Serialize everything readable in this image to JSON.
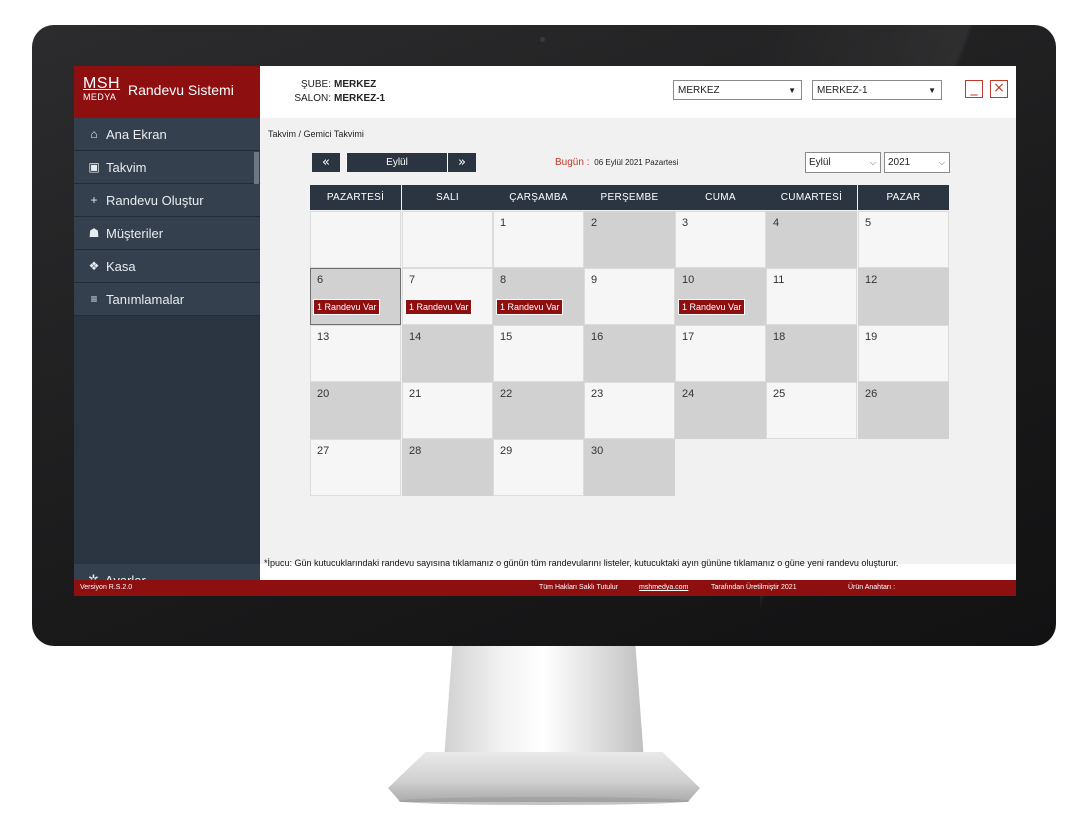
{
  "app": {
    "logo_top": "MSH",
    "logo_bottom": "MEDYA",
    "title": "Randevu Sistemi"
  },
  "sidebar": {
    "items": [
      {
        "icon": "home-icon",
        "glyph": "⌂",
        "label": "Ana Ekran"
      },
      {
        "icon": "calendar-icon",
        "glyph": "▣",
        "label": "Takvim"
      },
      {
        "icon": "plus-icon",
        "glyph": "+",
        "label": "Randevu Oluştur"
      },
      {
        "icon": "users-icon",
        "glyph": "☗",
        "label": "Müşteriler"
      },
      {
        "icon": "cash-icon",
        "glyph": "❖",
        "label": "Kasa"
      },
      {
        "icon": "list-icon",
        "glyph": "≡",
        "label": "Tanımlamalar"
      }
    ],
    "settings": {
      "icon": "gear-icon",
      "glyph": "✲",
      "label": "Ayarlar"
    }
  },
  "header": {
    "branch_label": "ŞUBE:",
    "branch_value": "MERKEZ",
    "salon_label": "SALON:",
    "salon_value": "MERKEZ-1",
    "branch_select": "MERKEZ",
    "salon_select": "MERKEZ-1",
    "minimize_glyph": "_",
    "close_glyph": "×"
  },
  "breadcrumb": "Takvim / Gemici Takvimi",
  "calendar": {
    "prev_glyph": "«",
    "next_glyph": "»",
    "month_label": "Eylül",
    "today_label": "Bugün :",
    "today_value": "06 Eylül 2021 Pazartesi",
    "month_select": "Eylül",
    "year_select": "2021",
    "weekdays": [
      "PAZARTESİ",
      "SALI",
      "ÇARŞAMBA",
      "PERŞEMBE",
      "CUMA",
      "CUMARTESİ",
      "PAZAR"
    ],
    "days": [
      {
        "d": "",
        "shade": "lt"
      },
      {
        "d": "",
        "shade": "lt"
      },
      {
        "d": "1",
        "shade": "lt"
      },
      {
        "d": "2",
        "shade": "dk"
      },
      {
        "d": "3",
        "shade": "lt"
      },
      {
        "d": "4",
        "shade": "dk"
      },
      {
        "d": "5",
        "shade": "lt"
      },
      {
        "d": "6",
        "shade": "dk",
        "badge": "1 Randevu Var",
        "today": true
      },
      {
        "d": "7",
        "shade": "lt",
        "badge": "1 Randevu Var"
      },
      {
        "d": "8",
        "shade": "dk",
        "badge": "1 Randevu Var"
      },
      {
        "d": "9",
        "shade": "lt"
      },
      {
        "d": "10",
        "shade": "dk",
        "badge": "1 Randevu Var"
      },
      {
        "d": "11",
        "shade": "lt"
      },
      {
        "d": "12",
        "shade": "dk"
      },
      {
        "d": "13",
        "shade": "lt"
      },
      {
        "d": "14",
        "shade": "dk"
      },
      {
        "d": "15",
        "shade": "lt"
      },
      {
        "d": "16",
        "shade": "dk"
      },
      {
        "d": "17",
        "shade": "lt"
      },
      {
        "d": "18",
        "shade": "dk"
      },
      {
        "d": "19",
        "shade": "lt"
      },
      {
        "d": "20",
        "shade": "dk"
      },
      {
        "d": "21",
        "shade": "lt"
      },
      {
        "d": "22",
        "shade": "dk"
      },
      {
        "d": "23",
        "shade": "lt"
      },
      {
        "d": "24",
        "shade": "dk"
      },
      {
        "d": "25",
        "shade": "lt"
      },
      {
        "d": "26",
        "shade": "dk"
      },
      {
        "d": "27",
        "shade": "lt"
      },
      {
        "d": "28",
        "shade": "dk"
      },
      {
        "d": "29",
        "shade": "lt"
      },
      {
        "d": "30",
        "shade": "dk"
      }
    ]
  },
  "tip": "*İpucu: Gün kutucuklarındaki randevu sayısına tıklamanız o günün tüm randevularını listeler, kutucuktaki ayın gününe tıklamanız o güne yeni randevu oluşturur.",
  "footer": {
    "version": "Versiyon R.S.2.0",
    "rights": "Tüm Hakları Saklı Tutulur",
    "link": "mshmedya.com",
    "made_by": "Tarafından Üretilmiştir 2021",
    "product_key": "Ürün Anahtarı :"
  },
  "colors": {
    "brand": "#8e0f10",
    "sidebar": "#2b3541",
    "header_cell": "#2b3541",
    "accent_text": "#c0392b"
  }
}
